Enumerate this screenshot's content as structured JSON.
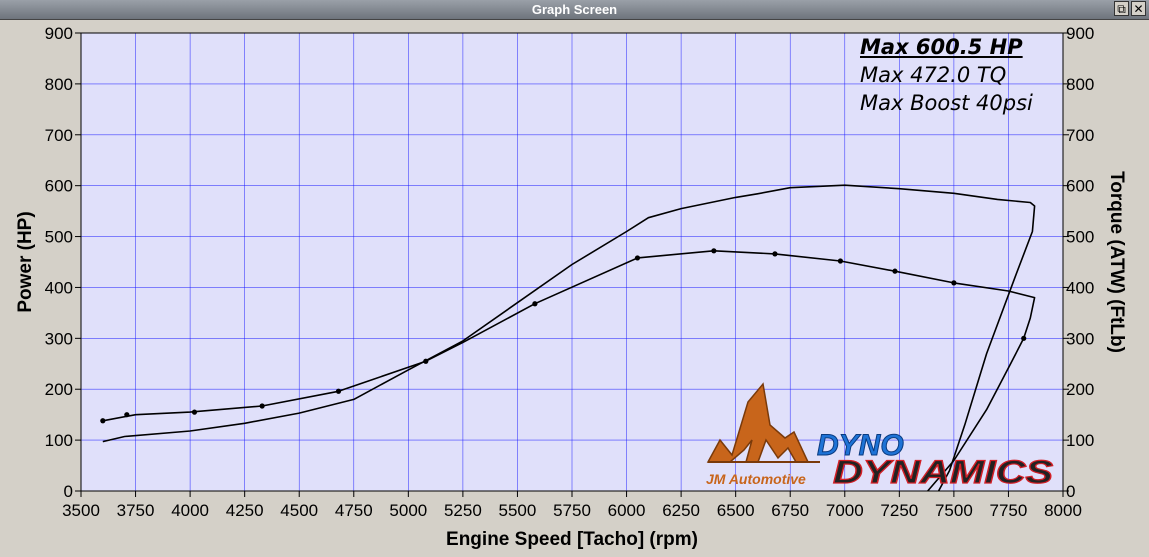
{
  "window": {
    "title": "Graph Screen",
    "restore_glyph": "⧉",
    "close_glyph": "✕"
  },
  "annotations": {
    "max_hp": "Max 600.5 HP",
    "max_tq": "Max 472.0 TQ",
    "max_boost": "Max Boost 40psi"
  },
  "logos": {
    "jm_text": "JM Automotive",
    "dyno_text_1": "DYNO",
    "dyno_text_2": "DYNAMICS"
  },
  "colors": {
    "plot_bg": "#e0e0fa",
    "grid": "#1a1aff",
    "curve": "#000000",
    "jm_orange": "#c8651b",
    "dyno_blue": "#1e73d6",
    "dyno_red": "#d21f26"
  },
  "chart_data": {
    "type": "line",
    "xlabel": "Engine Speed [Tacho] (rpm)",
    "ylabel_left": "Power (HP)",
    "ylabel_right": "Torque (ATW) (FtLb)",
    "xlim": [
      3500,
      8000
    ],
    "ylim": [
      0,
      900
    ],
    "xticks": [
      3500,
      3750,
      4000,
      4250,
      4500,
      4750,
      5000,
      5250,
      5500,
      5750,
      6000,
      6250,
      6500,
      6750,
      7000,
      7250,
      7500,
      7750,
      8000
    ],
    "yticks": [
      0,
      100,
      200,
      300,
      400,
      500,
      600,
      700,
      800,
      900
    ],
    "grid": true,
    "series": [
      {
        "points": [
          [
            3600,
            97
          ],
          [
            3700,
            107
          ],
          [
            4000,
            118
          ],
          [
            4250,
            133
          ],
          [
            4500,
            153
          ],
          [
            4750,
            180
          ],
          [
            5000,
            238
          ],
          [
            5250,
            295
          ],
          [
            5500,
            370
          ],
          [
            5750,
            445
          ],
          [
            6000,
            510
          ],
          [
            6100,
            537
          ],
          [
            6250,
            555
          ],
          [
            6500,
            577
          ],
          [
            6600,
            584
          ],
          [
            6750,
            596
          ],
          [
            7000,
            601
          ],
          [
            7250,
            594
          ],
          [
            7500,
            585
          ],
          [
            7700,
            573
          ],
          [
            7850,
            567
          ],
          [
            7870,
            560
          ],
          [
            7860,
            510
          ],
          [
            7780,
            420
          ],
          [
            7650,
            270
          ],
          [
            7550,
            130
          ],
          [
            7480,
            40
          ],
          [
            7430,
            0
          ]
        ]
      },
      {
        "points": [
          [
            3600,
            138
          ],
          [
            3750,
            150
          ],
          [
            4000,
            155
          ],
          [
            4330,
            167
          ],
          [
            4680,
            196
          ],
          [
            5080,
            255
          ],
          [
            5250,
            292
          ],
          [
            5580,
            368
          ],
          [
            6050,
            458
          ],
          [
            6400,
            472
          ],
          [
            6680,
            466
          ],
          [
            6980,
            452
          ],
          [
            7230,
            432
          ],
          [
            7500,
            409
          ],
          [
            7750,
            393
          ],
          [
            7870,
            380
          ],
          [
            7850,
            340
          ],
          [
            7820,
            300
          ],
          [
            7760,
            250
          ],
          [
            7650,
            160
          ],
          [
            7500,
            60
          ],
          [
            7380,
            0
          ]
        ],
        "markers": [
          [
            3600,
            138
          ],
          [
            3710,
            150
          ],
          [
            4020,
            155
          ],
          [
            4330,
            167
          ],
          [
            4680,
            196
          ],
          [
            5080,
            255
          ],
          [
            5580,
            368
          ],
          [
            6050,
            458
          ],
          [
            6400,
            472
          ],
          [
            6680,
            466
          ],
          [
            6980,
            452
          ],
          [
            7230,
            432
          ],
          [
            7500,
            409
          ],
          [
            7820,
            300
          ]
        ]
      }
    ]
  }
}
